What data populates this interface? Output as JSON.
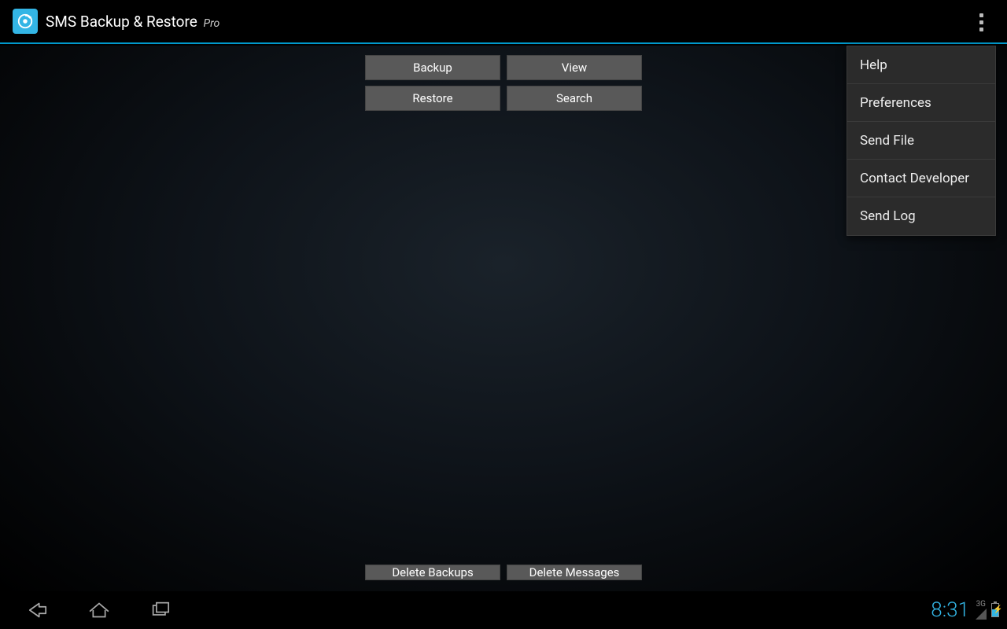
{
  "app": {
    "title_main": "SMS Backup & Restore",
    "title_suffix": "Pro"
  },
  "buttons": {
    "backup": "Backup",
    "view": "View",
    "restore": "Restore",
    "search": "Search",
    "delete_backups": "Delete Backups",
    "delete_messages": "Delete Messages"
  },
  "overflow": {
    "items": [
      "Help",
      "Preferences",
      "Send File",
      "Contact Developer",
      "Send Log"
    ]
  },
  "status": {
    "clock": "8:31",
    "network_label": "3G"
  }
}
